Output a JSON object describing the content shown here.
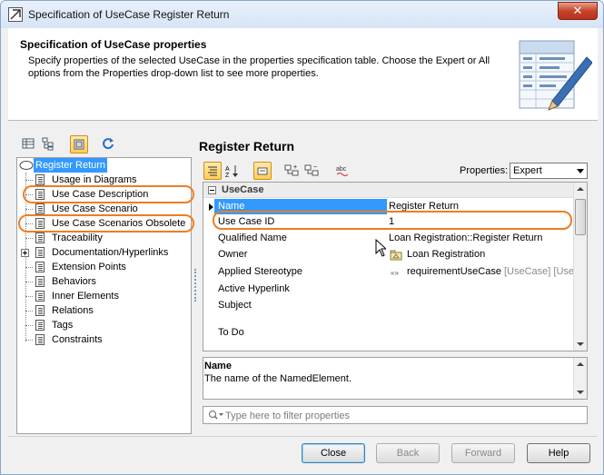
{
  "window": {
    "title": "Specification of UseCase Register Return",
    "close_glyph": "✕"
  },
  "header": {
    "title": "Specification of UseCase properties",
    "description": "Specify properties of the selected UseCase in the properties specification table. Choose the Expert or All options from the Properties drop-down list to see more properties.",
    "icon": "specification-document-pencil-icon"
  },
  "tree": {
    "toolbar_icons": [
      "table-view-icon",
      "tree-view-icon",
      "show-elements-icon",
      "refresh-icon"
    ],
    "root": "Register Return",
    "items": [
      "Usage in Diagrams",
      "Use Case Description",
      "Use Case Scenario",
      "Use Case Scenarios Obsolete",
      "Traceability",
      "Documentation/Hyperlinks",
      "Extension Points",
      "Behaviors",
      "Inner Elements",
      "Relations",
      "Tags",
      "Constraints"
    ]
  },
  "main": {
    "title": "Register Return",
    "toolbar_icons": [
      "categorized-view-icon",
      "sort-alphabetically-icon",
      "comment-icon",
      "expand-all-icon",
      "collapse-all-icon",
      "spelling-icon"
    ],
    "properties_label": "Properties:",
    "properties_mode": "Expert",
    "group": "UseCase",
    "rows": [
      {
        "name": "Name",
        "value": "Register Return"
      },
      {
        "name": "Use Case ID",
        "value": "1"
      },
      {
        "name": "Qualified Name",
        "value": "Loan Registration::Register Return"
      },
      {
        "name": "Owner",
        "value": "Loan Registration"
      },
      {
        "name": "Applied Stereotype",
        "value": "requirementUseCase",
        "value_extra": "[UseCase] [Use"
      },
      {
        "name": "Active Hyperlink",
        "value": ""
      },
      {
        "name": "Subject",
        "value": ""
      },
      {
        "name": "To Do",
        "value": ""
      }
    ],
    "description_title": "Name",
    "description_text": "The name of the NamedElement.",
    "filter_placeholder": "Type here to filter properties"
  },
  "buttons": {
    "close": "Close",
    "back": "Back",
    "forward": "Forward",
    "help": "Help"
  },
  "colors": {
    "selection": "#3399ff",
    "highlight_oval": "#ef7d22"
  }
}
